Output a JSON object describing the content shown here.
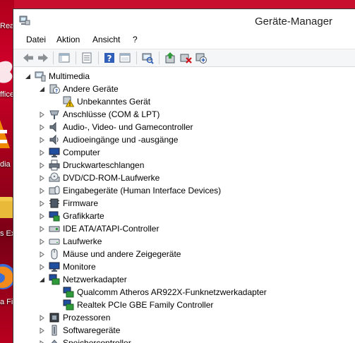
{
  "desktop": {
    "labels": [
      "Rea",
      "ffice",
      "dia",
      "s Ex",
      "a Fi"
    ]
  },
  "window": {
    "title": "Geräte-Manager"
  },
  "menu": [
    "Datei",
    "Aktion",
    "Ansicht",
    "?"
  ],
  "toolbar": {
    "buttons": [
      "back-icon",
      "forward-icon",
      "console-tree-icon",
      "properties-icon",
      "help-icon",
      "view-icon",
      "scan-hardware-icon",
      "update-driver-icon",
      "uninstall-icon",
      "disable-icon"
    ]
  },
  "tree": {
    "root": "Multimedia",
    "items": [
      {
        "label": "Andere Geräte",
        "expanded": true,
        "children": [
          "Unbekanntes Gerät"
        ]
      },
      {
        "label": "Anschlüsse (COM & LPT)"
      },
      {
        "label": "Audio-, Video- und Gamecontroller"
      },
      {
        "label": "Audioeingänge und -ausgänge"
      },
      {
        "label": "Computer"
      },
      {
        "label": "Druckwarteschlangen"
      },
      {
        "label": "DVD/CD-ROM-Laufwerke"
      },
      {
        "label": "Eingabegeräte (Human Interface Devices)"
      },
      {
        "label": "Firmware"
      },
      {
        "label": "Grafikkarte"
      },
      {
        "label": "IDE ATA/ATAPI-Controller"
      },
      {
        "label": "Laufwerke"
      },
      {
        "label": "Mäuse und andere Zeigegeräte"
      },
      {
        "label": "Monitore"
      },
      {
        "label": "Netzwerkadapter",
        "expanded": true,
        "children": [
          "Qualcomm Atheros AR922X-Funknetzwerkadapter",
          "Realtek PCIe GBE Family Controller"
        ]
      },
      {
        "label": "Prozessoren"
      },
      {
        "label": "Softwaregeräte"
      },
      {
        "label": "Speichercontroller"
      }
    ]
  }
}
